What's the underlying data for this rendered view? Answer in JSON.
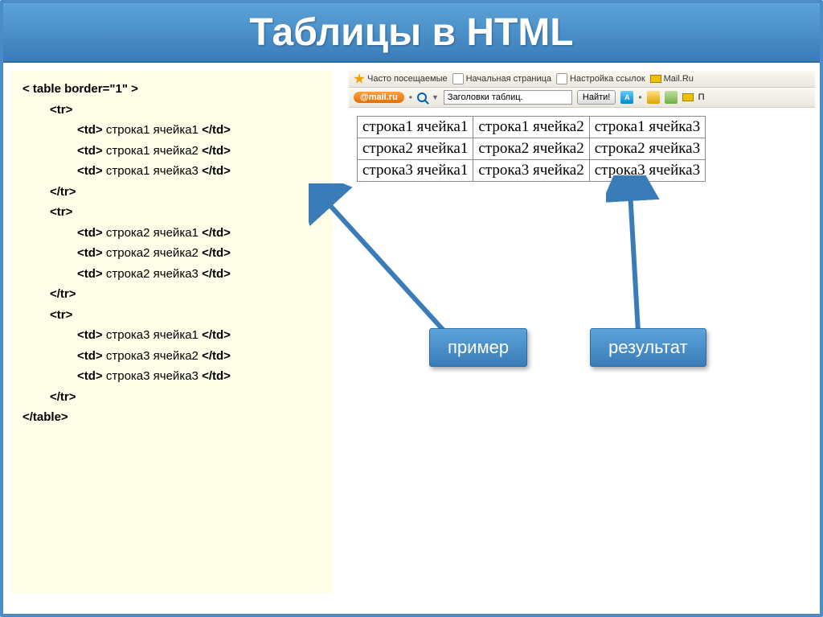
{
  "title": "Таблицы в HTML",
  "code": {
    "open_table": "< table border=\"1\" >",
    "tr_open": "<tr>",
    "tr_close": "</tr>",
    "table_close": "</table>",
    "rows": [
      [
        "<td> строка1 ячейка1 </td>",
        "<td> строка1 ячейка2 </td>",
        "<td> строка1 ячейка3 </td>"
      ],
      [
        "<td> строка2 ячейка1 </td>",
        "<td> строка2 ячейка2 </td>",
        "<td> строка2 ячейка3 </td>"
      ],
      [
        "<td> строка3 ячейка1 </td>",
        "<td> строка3 ячейка2 </td>",
        "<td> строка3 ячейка3 </td>"
      ]
    ]
  },
  "browser": {
    "bookmarks": {
      "frequent": "Часто посещаемые",
      "start": "Начальная страница",
      "links": "Настройка ссылок",
      "mail": "Mail.Ru"
    },
    "mail_badge": "@mail.ru",
    "search_value": "Заголовки таблиц.",
    "find_btn": "Найти!",
    "right_label": "П"
  },
  "table_data": [
    [
      "строка1 ячейка1",
      "строка1 ячейка2",
      "строка1 ячейка3"
    ],
    [
      "строка2 ячейка1",
      "строка2 ячейка2",
      "строка2 ячейка3"
    ],
    [
      "строка3 ячейка1",
      "строка3 ячейка2",
      "строка3 ячейка3"
    ]
  ],
  "labels": {
    "example": "пример",
    "result": "результат"
  }
}
